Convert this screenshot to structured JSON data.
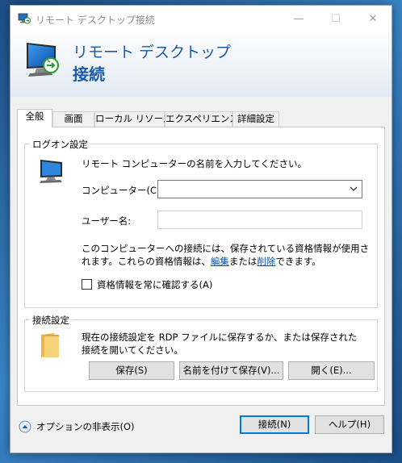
{
  "window": {
    "title": "リモート デスクトップ接続",
    "banner_line1": "リモート デスクトップ",
    "banner_line2": "接続",
    "titlebar_buttons": {
      "minimize": "—",
      "maximize": "☐",
      "close": "✕"
    }
  },
  "tabs": [
    {
      "label": "全般",
      "active": true
    },
    {
      "label": "画面",
      "active": false
    },
    {
      "label": "ローカル リソース",
      "active": false
    },
    {
      "label": "エクスペリエンス",
      "active": false
    },
    {
      "label": "詳細設定",
      "active": false
    }
  ],
  "logon": {
    "group_label": "ログオン設定",
    "prompt": "リモート コンピューターの名前を入力してください。",
    "computer_label": "コンピューター(C):",
    "computer_value": "",
    "username_label": "ユーザー名:",
    "username_value": "",
    "info_part1": "このコンピューターへの接続には、保存されている資格情報が使用されます。これらの資格情報は、",
    "info_link_edit": "編集",
    "info_part2": "または",
    "info_link_delete": "削除",
    "info_part3": "できます。",
    "always_ask_label": "資格情報を常に確認する(A)",
    "always_ask_checked": false
  },
  "connection": {
    "group_label": "接続設定",
    "description": "現在の接続設定を RDP ファイルに保存するか、または保存された接続を開いてください。",
    "save_label": "保存(S)",
    "save_as_label": "名前を付けて保存(V)...",
    "open_label": "開く(E)..."
  },
  "footer": {
    "options_label": "オプションの非表示(O)",
    "connect_label": "接続(N)",
    "help_label": "ヘルプ(H)"
  },
  "colors": {
    "banner_text": "#1a5aa6",
    "link": "#0a54b6",
    "default_button_border": "#0078d7",
    "desktop_bg": "#2f6fa8"
  },
  "icons": {
    "app": "remote-desktop-icon",
    "logon": "computer-icon",
    "connection": "folder-icon",
    "options": "collapse-arrow-icon"
  }
}
